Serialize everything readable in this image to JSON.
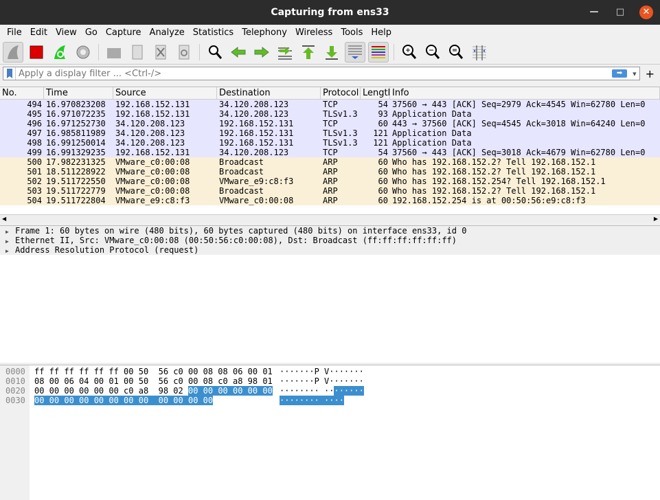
{
  "window": {
    "title": "Capturing from ens33"
  },
  "menu": [
    "File",
    "Edit",
    "View",
    "Go",
    "Capture",
    "Analyze",
    "Statistics",
    "Telephony",
    "Wireless",
    "Tools",
    "Help"
  ],
  "toolbar": [
    "start-capture",
    "stop-capture",
    "restart-capture",
    "capture-options",
    "open-file",
    "save-file",
    "close-file",
    "reload-file",
    "find-packet",
    "go-back",
    "go-forward",
    "go-to-packet",
    "go-first",
    "go-last",
    "auto-scroll",
    "colorize",
    "zoom-in",
    "zoom-out",
    "zoom-normal",
    "resize-columns"
  ],
  "filter": {
    "placeholder": "Apply a display filter ... <Ctrl-/>",
    "plus": "+",
    "dropdown": "▾"
  },
  "columns": [
    "No.",
    "Time",
    "Source",
    "Destination",
    "Protocol",
    "Length",
    "Info"
  ],
  "packets": [
    {
      "no": "494",
      "time": "16.970823208",
      "src": "192.168.152.131",
      "dst": "34.120.208.123",
      "proto": "TCP",
      "len": "54",
      "info": "37560 → 443 [ACK] Seq=2979 Ack=4545 Win=62780 Len=0",
      "cls": "tcp"
    },
    {
      "no": "495",
      "time": "16.971072235",
      "src": "192.168.152.131",
      "dst": "34.120.208.123",
      "proto": "TLSv1.3",
      "len": "93",
      "info": "Application Data",
      "cls": "tcp"
    },
    {
      "no": "496",
      "time": "16.971252730",
      "src": "34.120.208.123",
      "dst": "192.168.152.131",
      "proto": "TCP",
      "len": "60",
      "info": "443 → 37560 [ACK] Seq=4545 Ack=3018 Win=64240 Len=0",
      "cls": "tcp"
    },
    {
      "no": "497",
      "time": "16.985811989",
      "src": "34.120.208.123",
      "dst": "192.168.152.131",
      "proto": "TLSv1.3",
      "len": "121",
      "info": "Application Data",
      "cls": "tcp"
    },
    {
      "no": "498",
      "time": "16.991250014",
      "src": "34.120.208.123",
      "dst": "192.168.152.131",
      "proto": "TLSv1.3",
      "len": "121",
      "info": "Application Data",
      "cls": "tcp"
    },
    {
      "no": "499",
      "time": "16.991329235",
      "src": "192.168.152.131",
      "dst": "34.120.208.123",
      "proto": "TCP",
      "len": "54",
      "info": "37560 → 443 [ACK] Seq=3018 Ack=4679 Win=62780 Len=0",
      "cls": "tcp"
    },
    {
      "no": "500",
      "time": "17.982231325",
      "src": "VMware_c0:00:08",
      "dst": "Broadcast",
      "proto": "ARP",
      "len": "60",
      "info": "Who has 192.168.152.2? Tell 192.168.152.1",
      "cls": "arp"
    },
    {
      "no": "501",
      "time": "18.511228922",
      "src": "VMware_c0:00:08",
      "dst": "Broadcast",
      "proto": "ARP",
      "len": "60",
      "info": "Who has 192.168.152.2? Tell 192.168.152.1",
      "cls": "arp"
    },
    {
      "no": "502",
      "time": "19.511722550",
      "src": "VMware_c0:00:08",
      "dst": "VMware_e9:c8:f3",
      "proto": "ARP",
      "len": "60",
      "info": "Who has 192.168.152.254? Tell 192.168.152.1",
      "cls": "arp"
    },
    {
      "no": "503",
      "time": "19.511722779",
      "src": "VMware_c0:00:08",
      "dst": "Broadcast",
      "proto": "ARP",
      "len": "60",
      "info": "Who has 192.168.152.2? Tell 192.168.152.1",
      "cls": "arp"
    },
    {
      "no": "504",
      "time": "19.511722804",
      "src": "VMware_e9:c8:f3",
      "dst": "VMware_c0:00:08",
      "proto": "ARP",
      "len": "60",
      "info": "192.168.152.254 is at 00:50:56:e9:c8:f3",
      "cls": "arp"
    }
  ],
  "details": [
    "Frame 1: 60 bytes on wire (480 bits), 60 bytes captured (480 bits) on interface ens33, id 0",
    "Ethernet II, Src: VMware_c0:00:08 (00:50:56:c0:00:08), Dst: Broadcast (ff:ff:ff:ff:ff:ff)",
    "Address Resolution Protocol (request)"
  ],
  "bytes": [
    {
      "off": "0000",
      "hex": "ff ff ff ff ff ff 00 50  56 c0 00 08 08 06 00 01",
      "hexhl": "",
      "ascii": "·······P V·······",
      "asciihl": ""
    },
    {
      "off": "0010",
      "hex": "08 00 06 04 00 01 00 50  56 c0 00 08 c0 a8 98 01",
      "hexhl": "",
      "ascii": "·······P V·······",
      "asciihl": ""
    },
    {
      "off": "0020",
      "hex": "00 00 00 00 00 00 c0 a8  98 02 ",
      "hexhl": "00 00 00 00 00 00",
      "ascii": "········ ··",
      "asciihl": "······"
    },
    {
      "off": "0030",
      "hex": "",
      "hexhl": "00 00 00 00 00 00 00 00  00 00 00 00",
      "ascii": "",
      "asciihl": "········ ····"
    }
  ]
}
